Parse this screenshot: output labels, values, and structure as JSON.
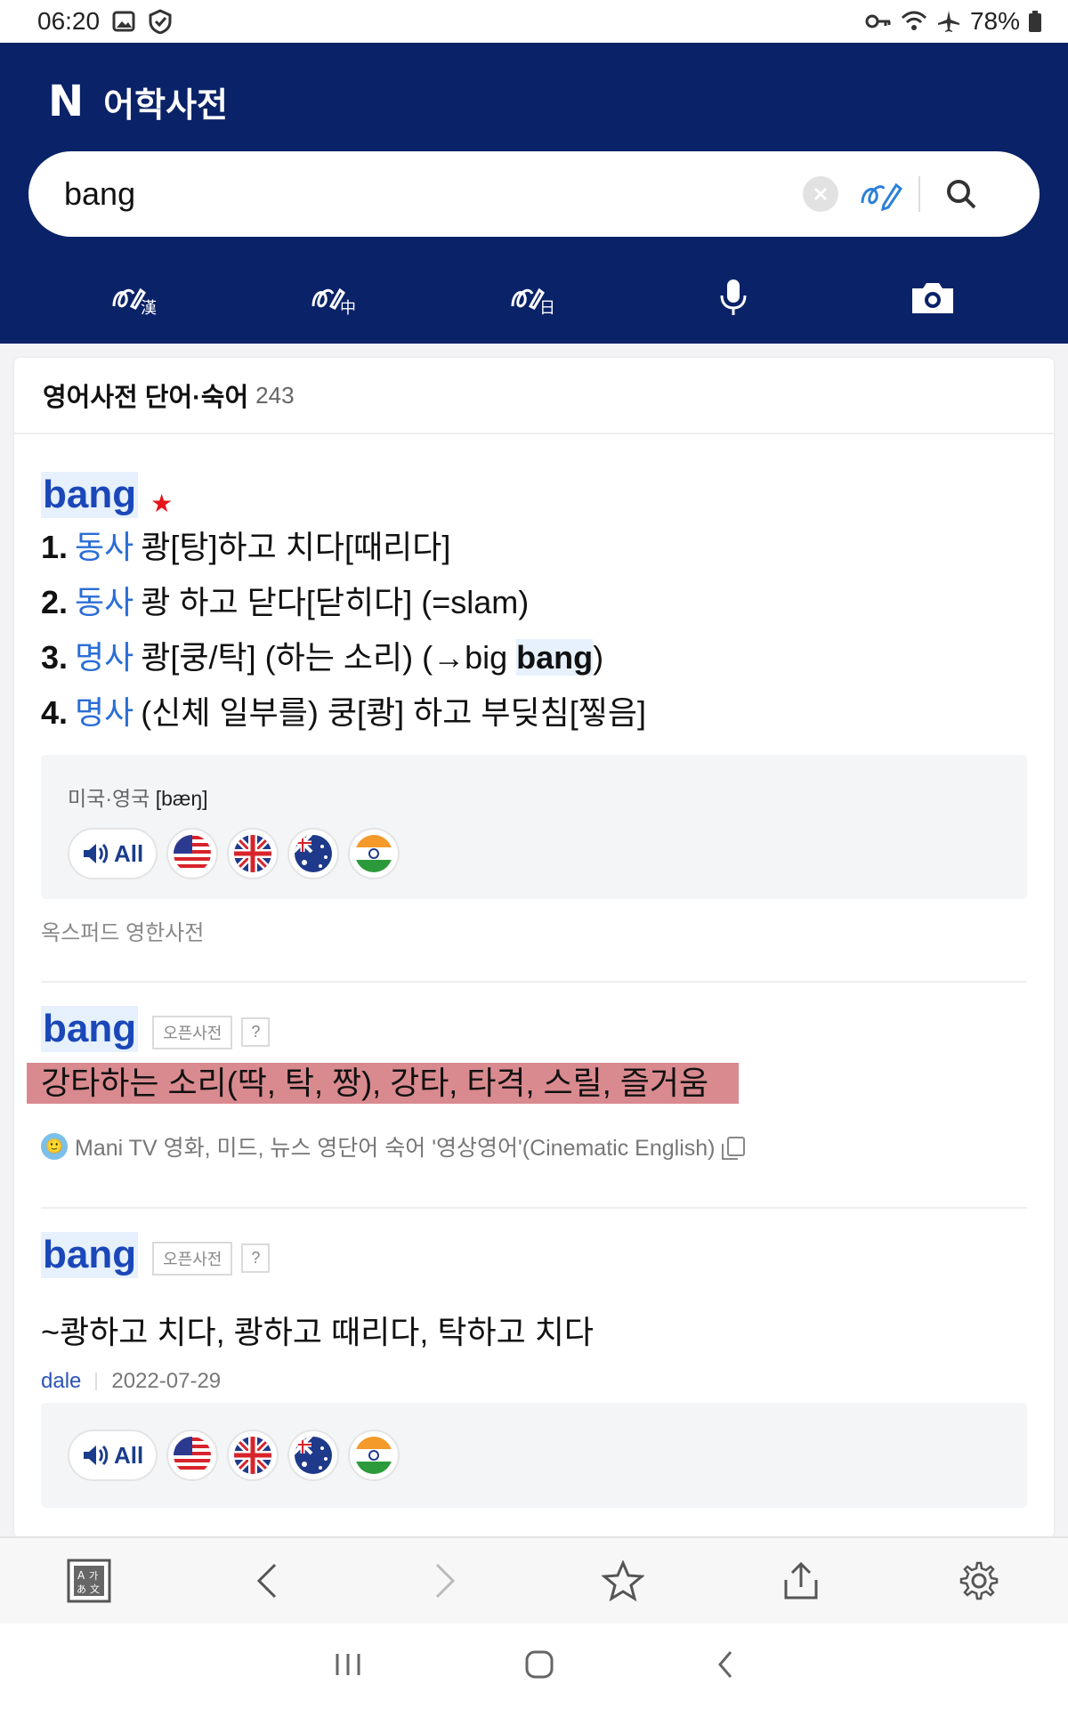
{
  "status_bar": {
    "time": "06:20",
    "battery": "78%"
  },
  "header": {
    "brand_logo": "N",
    "brand_title": "어학사전"
  },
  "search": {
    "value": "bang",
    "placeholder": ""
  },
  "tools": [
    {
      "icon": "hanja-handwriting-icon"
    },
    {
      "icon": "chinese-handwriting-icon"
    },
    {
      "icon": "japanese-handwriting-icon"
    },
    {
      "icon": "microphone-icon"
    },
    {
      "icon": "camera-icon"
    }
  ],
  "section": {
    "title": "영어사전 단어·숙어",
    "count": "243"
  },
  "entry1": {
    "word": "bang",
    "senses": [
      {
        "num": "1.",
        "pos": "동사",
        "text": "쾅[탕]하고 치다[때리다]"
      },
      {
        "num": "2.",
        "pos": "동사",
        "text": "쾅 하고 닫다[닫히다] (=slam)"
      },
      {
        "num": "3.",
        "pos": "명사",
        "text_before": "쾅[쿵/탁] (하는 소리) (→big ",
        "text_hl": "bang",
        "text_after": ")"
      },
      {
        "num": "4.",
        "pos": "명사",
        "text": "(신체 일부를) 쿵[쾅] 하고 부딪침[찧음]"
      }
    ],
    "pron_label": "미국·영국",
    "pron_ipa": "[bæŋ]",
    "audio_all": "All",
    "source": "옥스퍼드 영한사전"
  },
  "entry2": {
    "word": "bang",
    "tag": "오픈사전",
    "q": "?",
    "definition": "강타하는 소리(딱, 탁, 짱), 강타, 타격, 스릴, 즐거움",
    "source": "Mani TV 영화, 미드, 뉴스 영단어 숙어 '영상영어'(Cinematic English)"
  },
  "entry3": {
    "word": "bang",
    "tag": "오픈사전",
    "q": "?",
    "definition": "~쾅하고 치다, 쾅하고 때리다, 탁하고 치다",
    "user": "dale",
    "date": "2022-07-29",
    "audio_all": "All"
  },
  "colors": {
    "header_bg": "#0a2267",
    "word_color": "#1b47b8",
    "pos_color": "#2b6ed6",
    "star": "#e4161a",
    "highlight": "#d98a8f"
  }
}
